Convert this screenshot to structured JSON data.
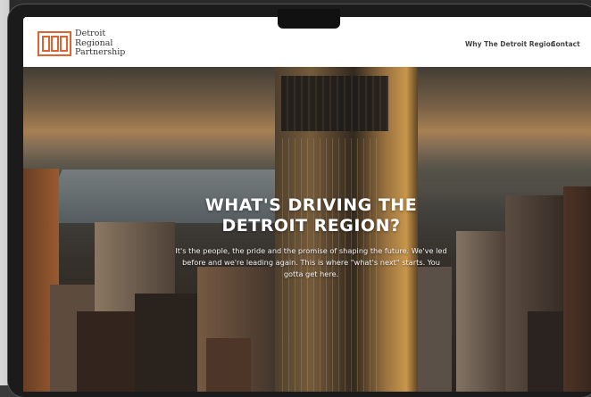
{
  "brand": {
    "name_line1": "Detroit",
    "name_line2": "Regional",
    "name_line3": "Partnership",
    "logo_letters": "DRP",
    "accent_color": "#e0622c"
  },
  "nav": {
    "links": [
      "Why The Detroit Region",
      "Contact"
    ]
  },
  "hero": {
    "title_line1": "WHAT'S DRIVING THE",
    "title_line2": "DETROIT REGION?",
    "subtitle": "It's the people, the pride and the promise of shaping the future. We've led before and we're leading again. This is where \"what's next\" starts. You gotta get here."
  }
}
